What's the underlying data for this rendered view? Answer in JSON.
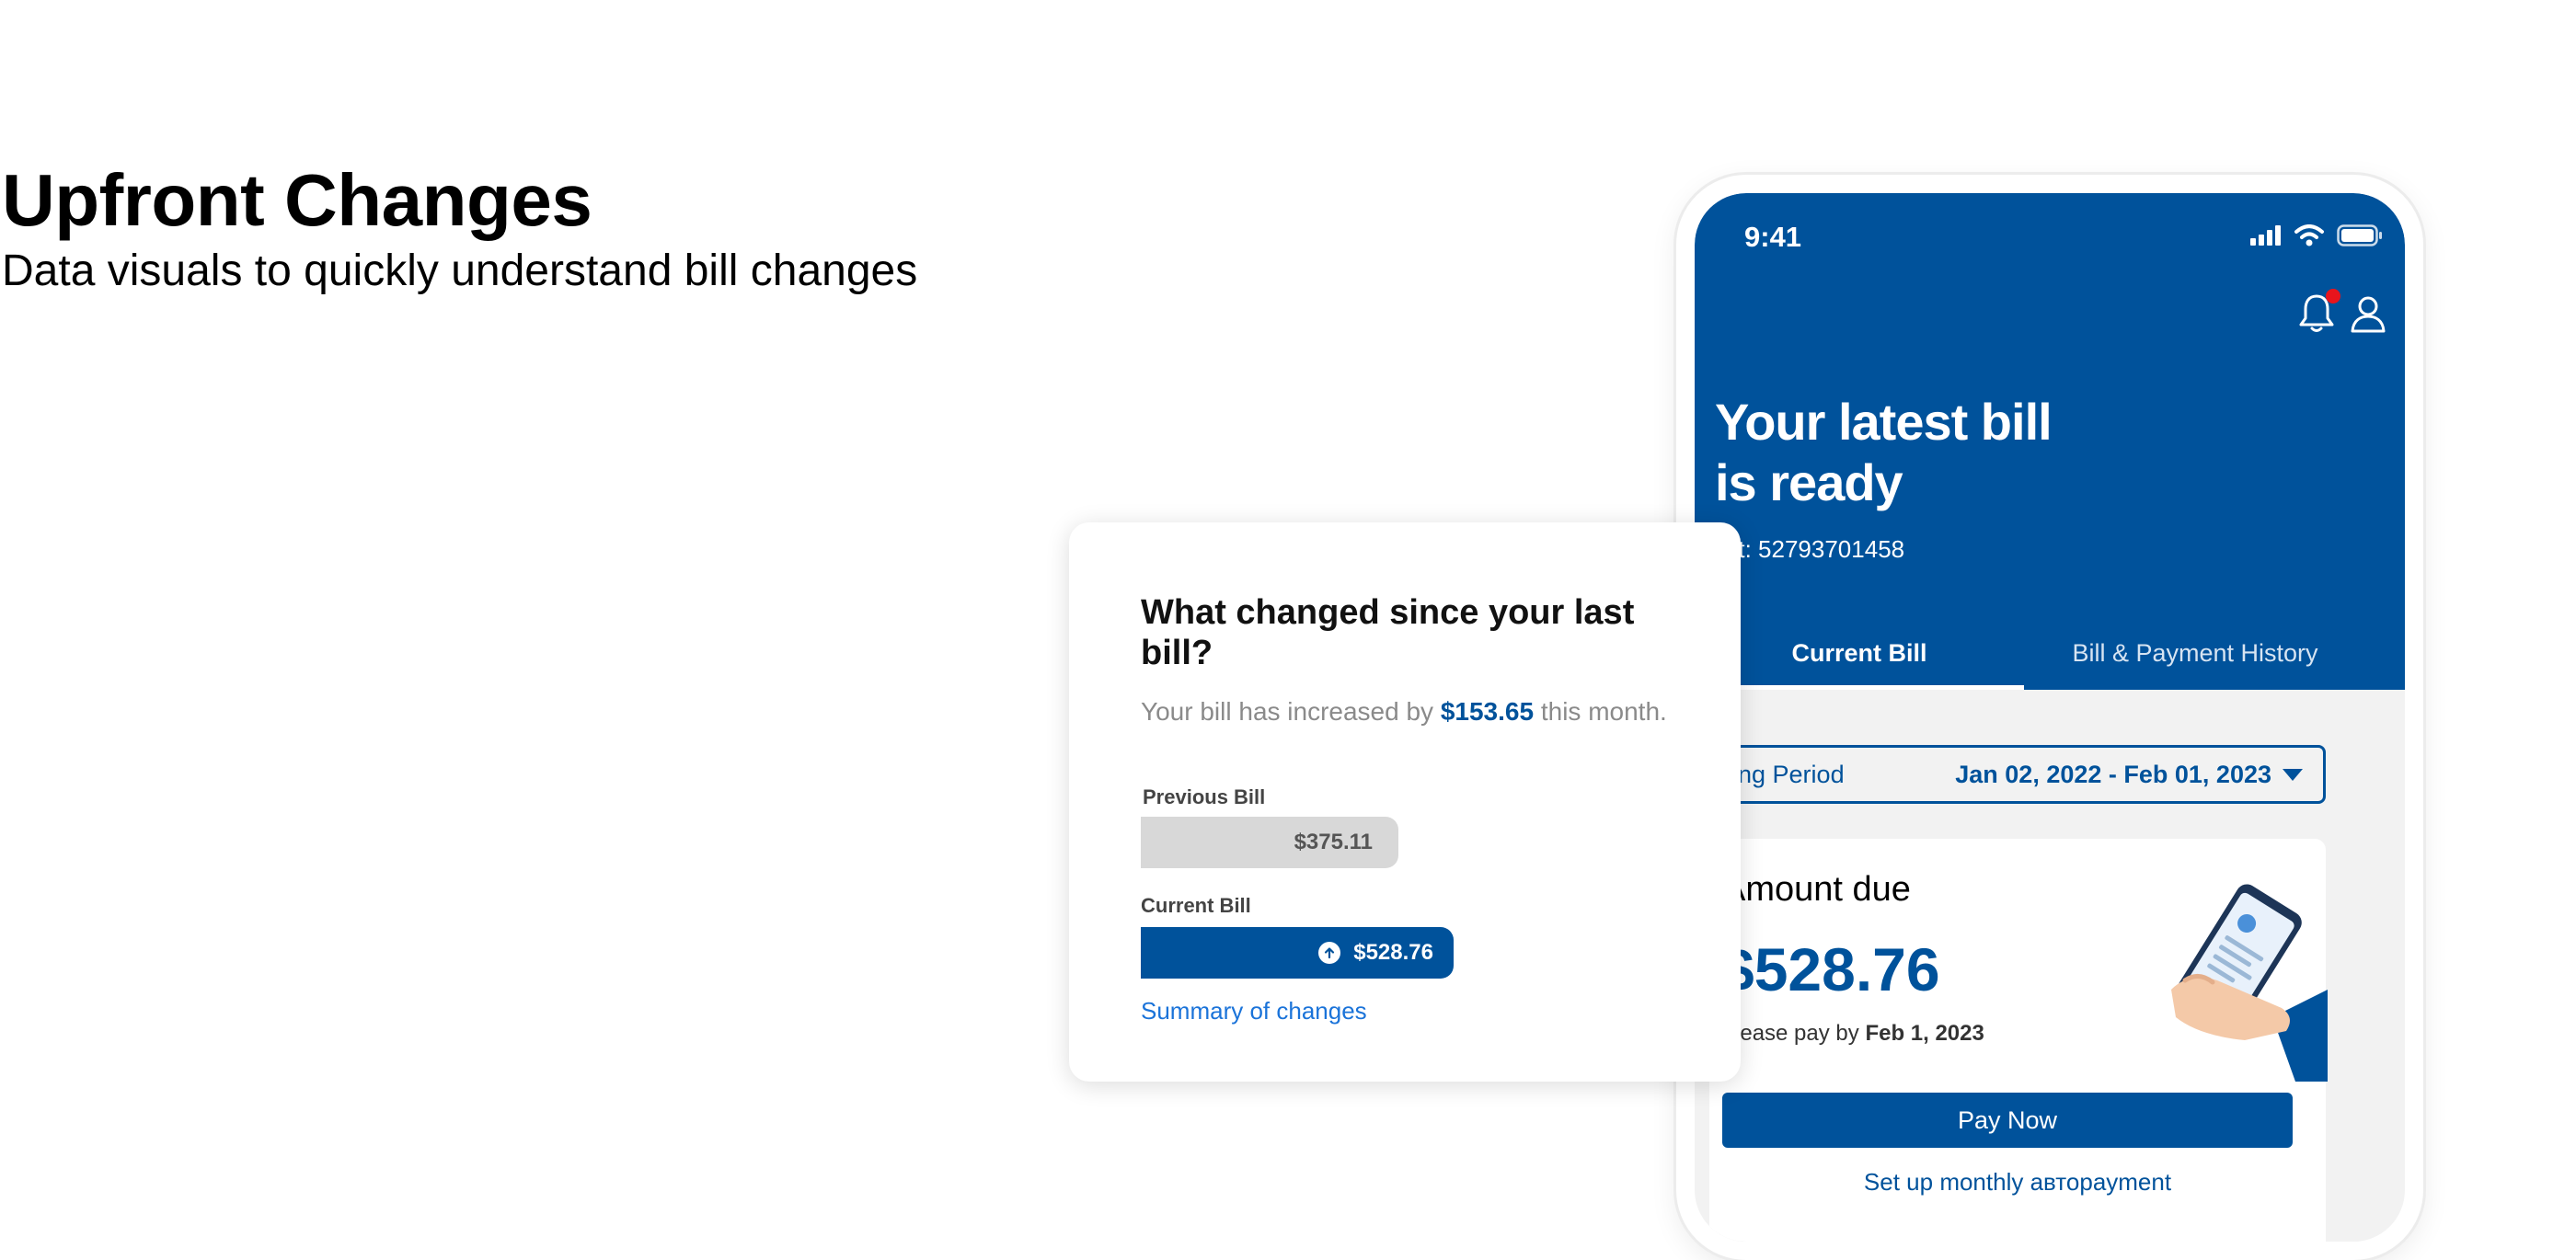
{
  "page": {
    "title": "Upfront Changes",
    "subtitle": "Data visuals to quickly understand bill changes"
  },
  "phone": {
    "status_time": "9:41",
    "icons": [
      "signal-icon",
      "wifi-icon",
      "battery-icon",
      "bell-icon",
      "user-icon"
    ],
    "title": "Your latest bill is ready",
    "account_text": "ccount: 52793701458",
    "tabs": [
      {
        "label": "Current Bill",
        "active": true
      },
      {
        "label": "Bill & Payment History",
        "active": false
      }
    ],
    "billing_period": {
      "label": "Billing Period",
      "value": "Jan 02, 2022 - Feb 01, 2023"
    },
    "amount_due": {
      "label": "Amount due",
      "value": "$528.76",
      "pay_by_prefix": "Please pay by",
      "pay_by_date": "Feb 1, 2023"
    },
    "pay_button": "Pay Now",
    "autopay_text": "Set up monthly автоpayment"
  },
  "changes_card": {
    "title": "What changed since your last bill?",
    "desc_prefix": "Your bill has increased by",
    "desc_amount": "$153.65",
    "desc_suffix": "this month.",
    "previous_label": "Previous Bill",
    "previous_value": "$375.11",
    "current_label": "Current Bill",
    "current_value": "$528.76",
    "link": "Summary of changes"
  },
  "colors": {
    "brand_blue": "#00529b",
    "link_blue": "#1a73d9",
    "notification_red": "#e8141c"
  }
}
